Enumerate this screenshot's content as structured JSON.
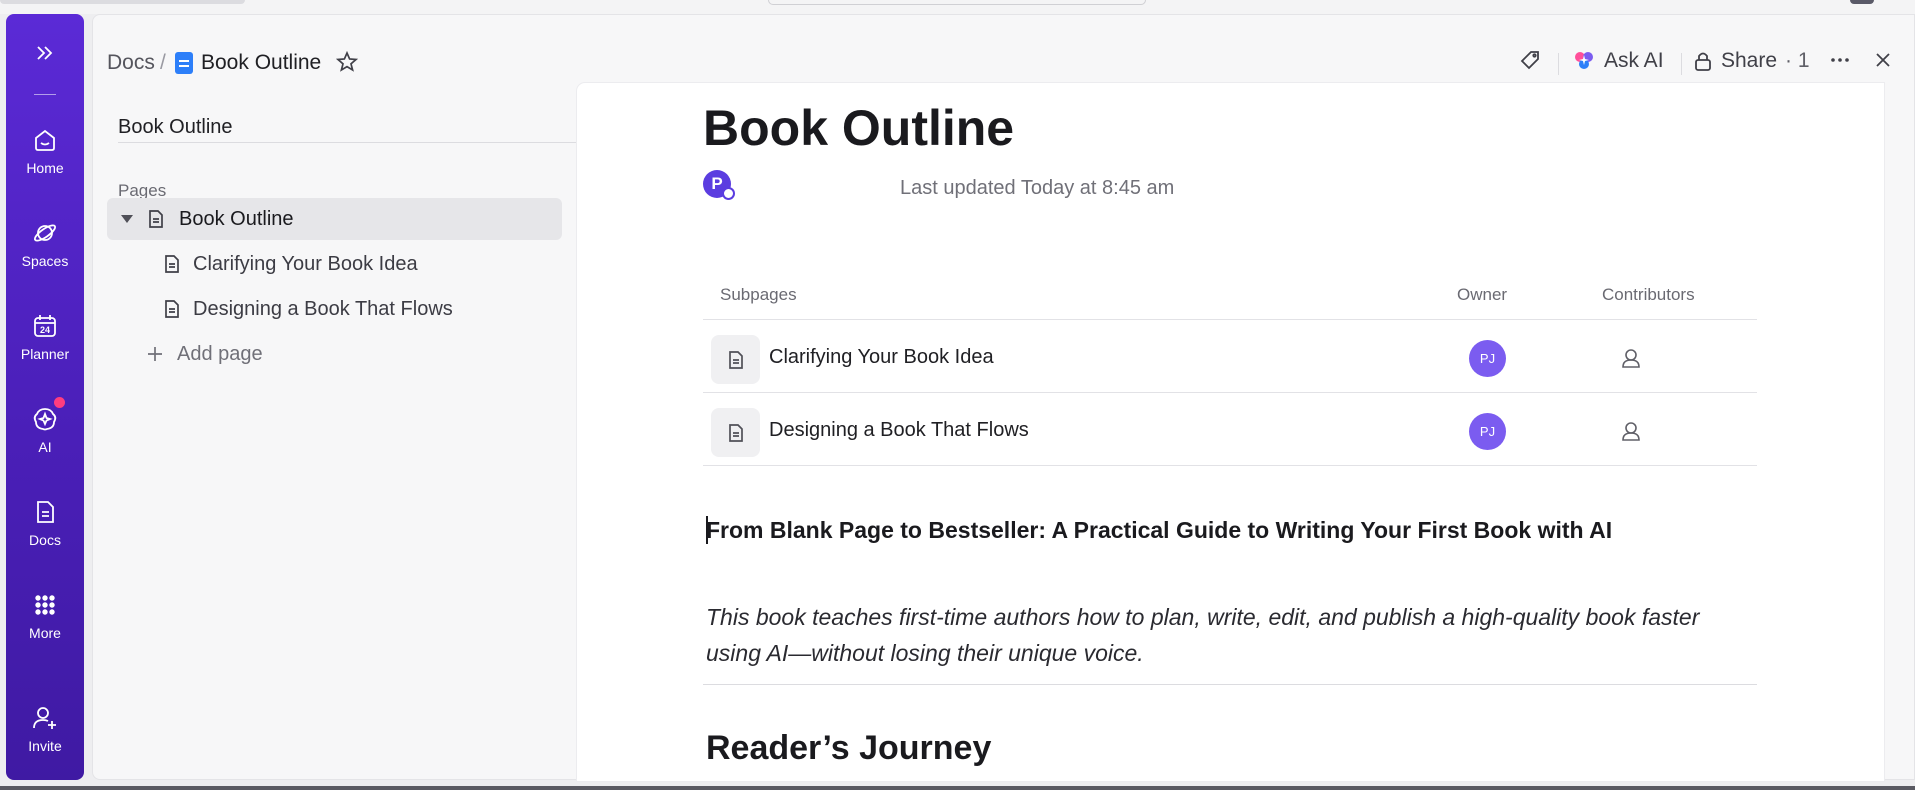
{
  "rail": {
    "home": "Home",
    "spaces": "Spaces",
    "planner": "Planner",
    "planner_day": "24",
    "ai": "AI",
    "docs": "Docs",
    "more": "More",
    "invite": "Invite"
  },
  "breadcrumb": {
    "root": "Docs",
    "separator": "/",
    "current": "Book Outline"
  },
  "toolbar": {
    "ask_ai": "Ask AI",
    "share": "Share",
    "share_count": "· 1"
  },
  "sidebar": {
    "title": "Book Outline",
    "pages_label": "Pages",
    "pages": [
      {
        "label": "Book Outline"
      },
      {
        "label": "Clarifying Your Book Idea"
      },
      {
        "label": "Designing a Book That Flows"
      }
    ],
    "add_page": "Add page"
  },
  "doc": {
    "title": "Book Outline",
    "author_initial": "P",
    "last_updated": "Last updated Today at 8:45 am",
    "subpages_table": {
      "headers": {
        "subpages": "Subpages",
        "owner": "Owner",
        "contributors": "Contributors"
      },
      "rows": [
        {
          "name": "Clarifying Your Book Idea",
          "owner": "PJ"
        },
        {
          "name": "Designing a Book That Flows",
          "owner": "PJ"
        }
      ]
    },
    "heading": "From Blank Page to Bestseller: A Practical Guide to Writing Your First Book with AI",
    "summary": "This book teaches first-time authors how to plan, write, edit, and publish a high-quality book faster using AI—without losing their unique voice.",
    "section_heading": "Reader’s Journey"
  },
  "right_tools": {
    "font": "Aa"
  },
  "colors": {
    "rail": "#4a1fb8",
    "accent": "#2d7ff9",
    "avatar": "#7b5cf0",
    "badge": "#ff3d7f"
  }
}
